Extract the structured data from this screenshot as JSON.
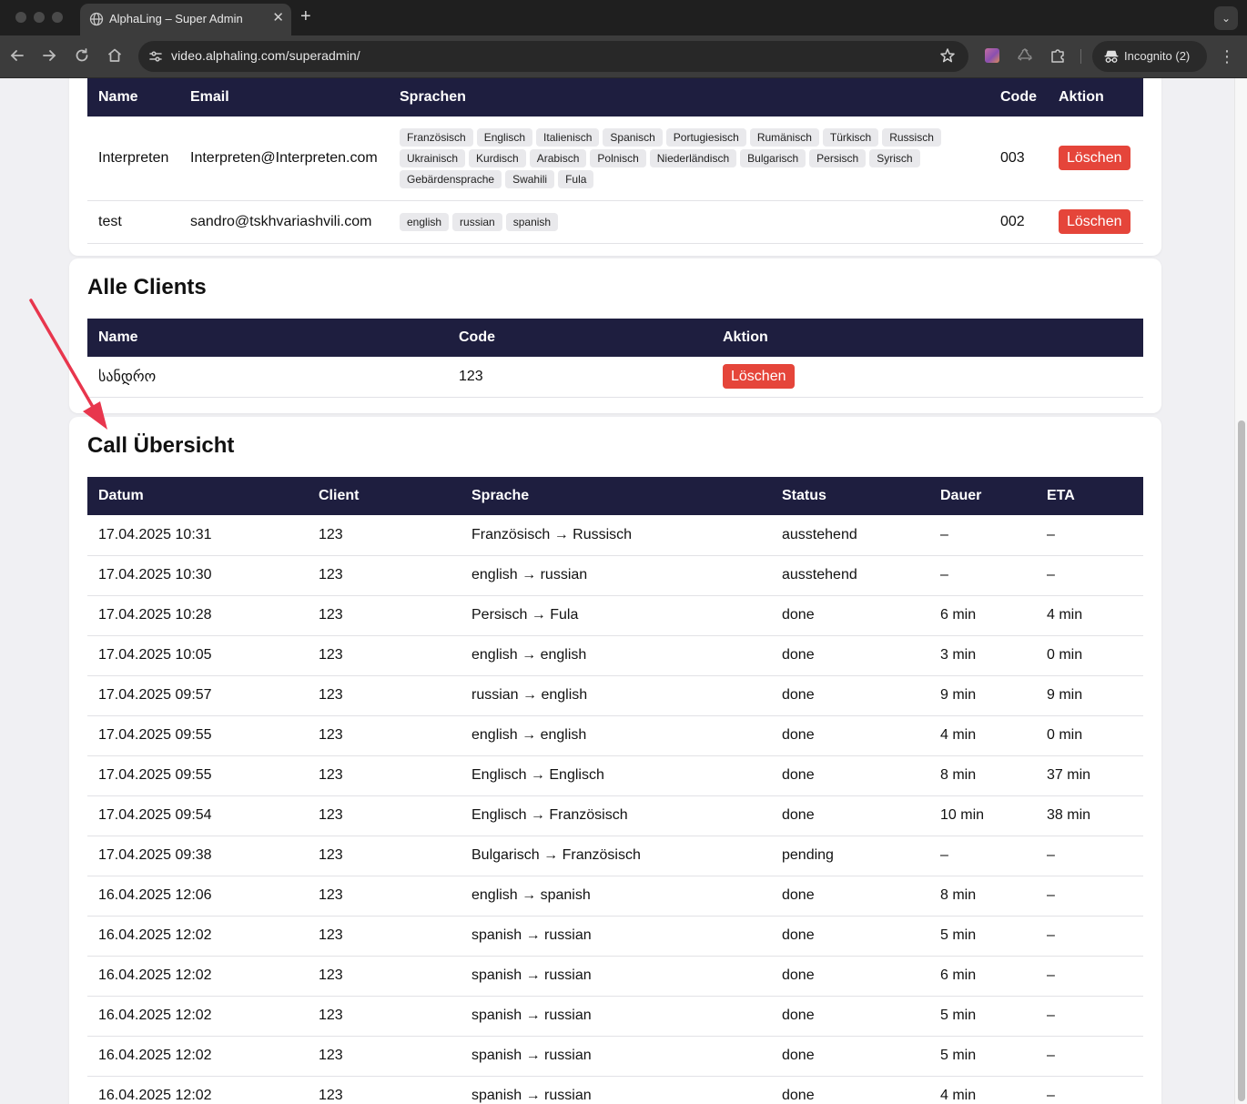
{
  "browser": {
    "tab_title": "AlphaLing – Super Admin",
    "url": "video.alphaling.com/superadmin/",
    "incognito_label": "Incognito (2)"
  },
  "interpreters": {
    "headers": [
      "Name",
      "Email",
      "Sprachen",
      "Code",
      "Aktion"
    ],
    "rows": [
      {
        "name": "Interpreten",
        "email": "Interpreten@Interpreten.com",
        "languages": [
          "Französisch",
          "Englisch",
          "Italienisch",
          "Spanisch",
          "Portugiesisch",
          "Rumänisch",
          "Türkisch",
          "Russisch",
          "Ukrainisch",
          "Kurdisch",
          "Arabisch",
          "Polnisch",
          "Niederländisch",
          "Bulgarisch",
          "Persisch",
          "Syrisch",
          "Gebärdensprache",
          "Swahili",
          "Fula"
        ],
        "code": "003",
        "action": "Löschen"
      },
      {
        "name": "test",
        "email": "sandro@tskhvariashvili.com",
        "languages": [
          "english",
          "russian",
          "spanish"
        ],
        "code": "002",
        "action": "Löschen"
      }
    ]
  },
  "clients": {
    "title": "Alle Clients",
    "headers": [
      "Name",
      "Code",
      "Aktion"
    ],
    "rows": [
      {
        "name": "სანდრო",
        "code": "123",
        "action": "Löschen"
      }
    ]
  },
  "calls": {
    "title": "Call Übersicht",
    "headers": [
      "Datum",
      "Client",
      "Sprache",
      "Status",
      "Dauer",
      "ETA"
    ],
    "rows": [
      [
        "17.04.2025 10:31",
        "123",
        "Französisch → Russisch",
        "ausstehend",
        "–",
        "–"
      ],
      [
        "17.04.2025 10:30",
        "123",
        "english → russian",
        "ausstehend",
        "–",
        "–"
      ],
      [
        "17.04.2025 10:28",
        "123",
        "Persisch → Fula",
        "done",
        "6 min",
        "4 min"
      ],
      [
        "17.04.2025 10:05",
        "123",
        "english → english",
        "done",
        "3 min",
        "0 min"
      ],
      [
        "17.04.2025 09:57",
        "123",
        "russian → english",
        "done",
        "9 min",
        "9 min"
      ],
      [
        "17.04.2025 09:55",
        "123",
        "english → english",
        "done",
        "4 min",
        "0 min"
      ],
      [
        "17.04.2025 09:55",
        "123",
        "Englisch → Englisch",
        "done",
        "8 min",
        "37 min"
      ],
      [
        "17.04.2025 09:54",
        "123",
        "Englisch → Französisch",
        "done",
        "10 min",
        "38 min"
      ],
      [
        "17.04.2025 09:38",
        "123",
        "Bulgarisch → Französisch",
        "pending",
        "–",
        "–"
      ],
      [
        "16.04.2025 12:06",
        "123",
        "english → spanish",
        "done",
        "8 min",
        "–"
      ],
      [
        "16.04.2025 12:02",
        "123",
        "spanish → russian",
        "done",
        "5 min",
        "–"
      ],
      [
        "16.04.2025 12:02",
        "123",
        "spanish → russian",
        "done",
        "6 min",
        "–"
      ],
      [
        "16.04.2025 12:02",
        "123",
        "spanish → russian",
        "done",
        "5 min",
        "–"
      ],
      [
        "16.04.2025 12:02",
        "123",
        "spanish → russian",
        "done",
        "5 min",
        "–"
      ],
      [
        "16.04.2025 12:02",
        "123",
        "spanish → russian",
        "done",
        "4 min",
        "–"
      ]
    ]
  },
  "colors": {
    "table_header": "#1e1e3f",
    "delete_button": "#e5453a",
    "annotation_arrow": "#e8364d"
  }
}
